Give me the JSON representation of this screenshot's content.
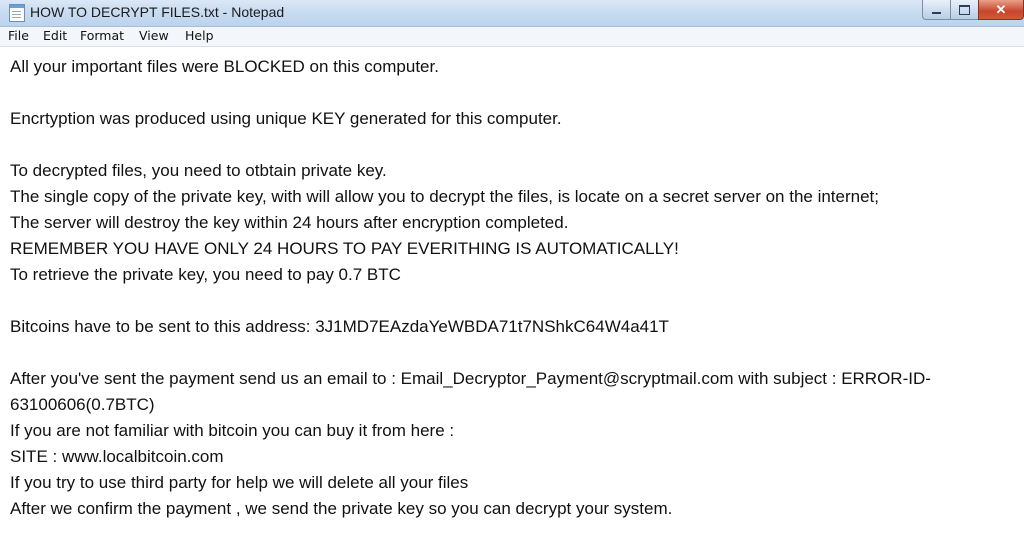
{
  "window": {
    "title": "HOW TO DECRYPT FILES.txt - Notepad",
    "icon": "notepad-icon"
  },
  "menu": {
    "items": [
      "File",
      "Edit",
      "Format",
      "View",
      "Help"
    ]
  },
  "document": {
    "lines": [
      "All your important files were BLOCKED on this computer.",
      "Encrtyption was produced using unique KEY generated for this computer.",
      "To decrypted files, you need to otbtain private key.",
      "The single copy of the private key, with will allow you to decrypt the files, is locate on a secret server on the internet;",
      "The server will destroy the key within 24 hours after encryption completed.",
      "REMEMBER YOU HAVE ONLY 24 HOURS TO PAY EVERITHING IS AUTOMATICALLY!",
      "To retrieve the private key, you need to pay 0.7 BTC",
      "Bitcoins have to be sent to this address: 3J1MD7EAzdaYeWBDA71t7NShkC64W4a41T",
      "After you've sent the payment send us an email to : Email_Decryptor_Payment@scryptmail.com with subject : ERROR-ID-",
      "63100606(0.7BTC)",
      "If you are not familiar with bitcoin you can buy it from here :",
      "SITE : www.localbitcoin.com",
      "If you try to use third party for help we will delete all your files",
      "After we confirm the payment , we send the private key so you can decrypt your system."
    ]
  }
}
